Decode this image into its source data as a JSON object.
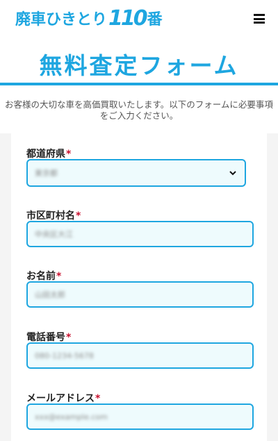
{
  "header": {
    "logo_text": "廃車ひきとり",
    "logo_num": "110",
    "logo_suffix": "番",
    "menu_icon": "hamburger-menu-icon"
  },
  "page": {
    "title": "無料査定フォーム",
    "intro": "お客様の大切な車を高価買取いたします。以下のフォームに必要事項をご入力ください。"
  },
  "form": {
    "required_mark": "*",
    "fields": [
      {
        "label": "都道府県",
        "value": "東京都",
        "type": "select"
      },
      {
        "label": "市区町村名",
        "value": "中央区大江",
        "type": "text"
      },
      {
        "label": "お名前",
        "value": "山田太郎",
        "type": "text"
      },
      {
        "label": "電話番号",
        "value": "080-1234-5678",
        "type": "text"
      },
      {
        "label": "メールアドレス",
        "value": "xxx@example.com",
        "type": "text"
      }
    ]
  },
  "colors": {
    "accent": "#1ea6e0",
    "required": "#c8102e",
    "input_bg": "#eefbfd"
  }
}
